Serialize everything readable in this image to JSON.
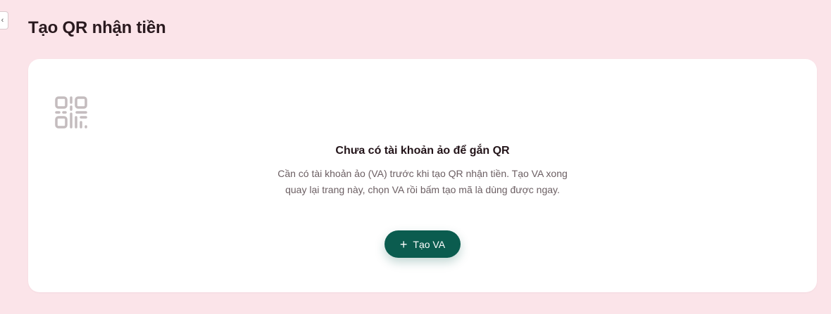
{
  "header": {
    "back_glyph": "‹",
    "title": "Tạo QR nhận tiền"
  },
  "empty_state": {
    "icon": "qr-code-icon",
    "title": "Chưa có tài khoản ảo để gắn QR",
    "description": "Cần có tài khoản ảo (VA) trước khi tạo QR nhận tiền. Tạo VA xong quay lại trang này, chọn VA rồi bấm tạo mã là dùng được ngay.",
    "button_label": "Tạo VA",
    "button_icon": "plus-icon"
  },
  "colors": {
    "background": "#fbe4e9",
    "card": "#ffffff",
    "accent": "#0b5c4f",
    "icon_gray": "#c4bcbe"
  }
}
